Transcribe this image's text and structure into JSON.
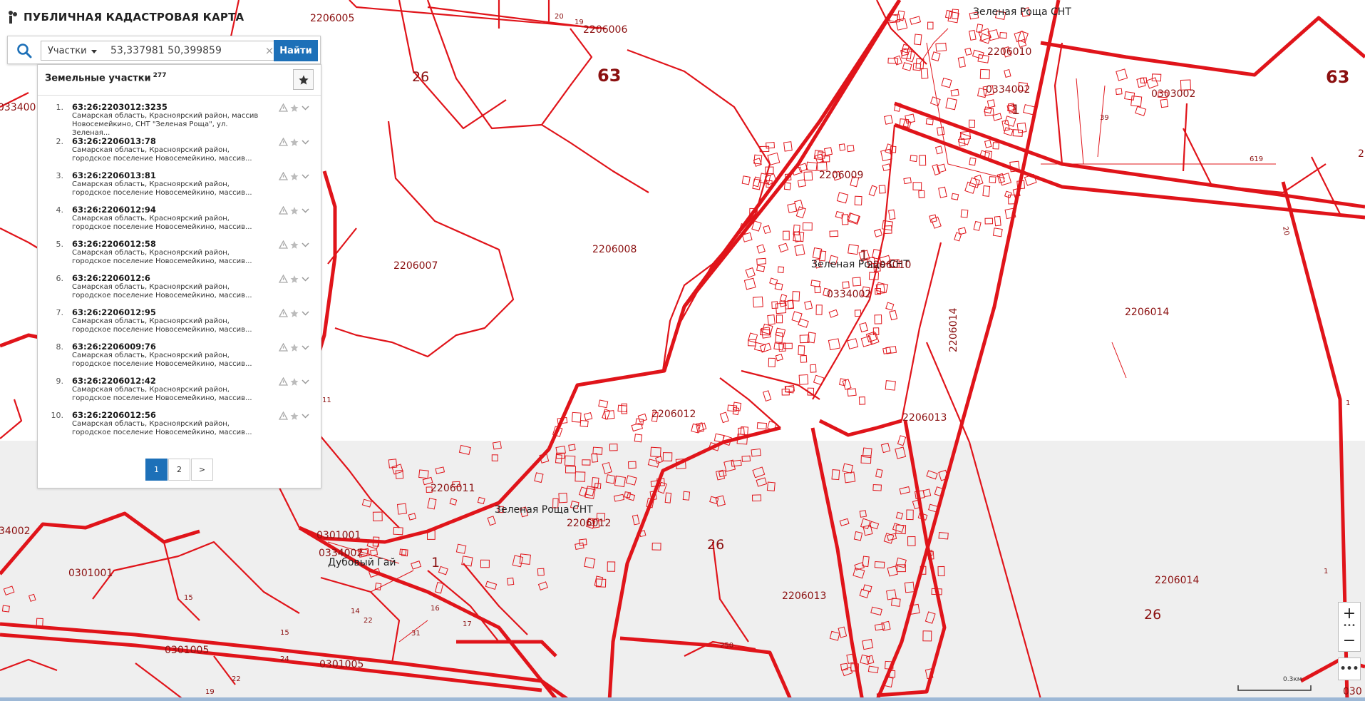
{
  "app": {
    "title": "ПУБЛИЧНАЯ КАДАСТРОВАЯ КАРТА"
  },
  "search": {
    "type_label": "Участки",
    "query": "53,337981 50,399859",
    "clear_symbol": "×",
    "find_label": "Найти"
  },
  "results": {
    "title": "Земельные участки",
    "count": "277",
    "items": [
      {
        "num": "1.",
        "code": "63:26:2203012:3235",
        "address": "Самарская область, Красноярский район, массив Новосемейкино, СНТ \"Зеленая Роща\", ул. Зеленая..."
      },
      {
        "num": "2.",
        "code": "63:26:2206013:78",
        "address": "Самарская область, Красноярский район, городское поселение Новосемейкино, массив..."
      },
      {
        "num": "3.",
        "code": "63:26:2206013:81",
        "address": "Самарская область, Красноярский район, городское поселение Новосемейкино, массив..."
      },
      {
        "num": "4.",
        "code": "63:26:2206012:94",
        "address": "Самарская область, Красноярский район, городское поселение Новосемейкино, массив..."
      },
      {
        "num": "5.",
        "code": "63:26:2206012:58",
        "address": "Самарская область, Красноярский район, городское поселение Новосемейкино, массив..."
      },
      {
        "num": "6.",
        "code": "63:26:2206012:6",
        "address": "Самарская область, Красноярский район, городское поселение Новосемейкино, массив..."
      },
      {
        "num": "7.",
        "code": "63:26:2206012:95",
        "address": "Самарская область, Красноярский район, городское поселение Новосемейкино, массив..."
      },
      {
        "num": "8.",
        "code": "63:26:2206009:76",
        "address": "Самарская область, Красноярский район, городское поселение Новосемейкино, массив..."
      },
      {
        "num": "9.",
        "code": "63:26:2206012:42",
        "address": "Самарская область, Красноярский район, городское поселение Новосемейкино, массив..."
      },
      {
        "num": "10.",
        "code": "63:26:2206012:56",
        "address": "Самарская область, Красноярский район, городское поселение Новосемейкино, массив..."
      }
    ],
    "pages": [
      "1",
      "2",
      ">"
    ],
    "active_page": "1"
  },
  "map": {
    "boundary_color": "#e0141a",
    "label_color": "#8b1010",
    "labels": {
      "q2206005": "2206005",
      "q2206006": "2206006",
      "d26_top": "26",
      "d63_top": "63",
      "d63_right": "63",
      "q0334001": "0334001",
      "q2206007": "2206007",
      "q2206008": "2206008",
      "q2206009": "2206009",
      "q2206010_top": "2206010",
      "q2206010_mid": "2206010",
      "q0334002_top": "0334002",
      "q0334002_mid": "0334002",
      "q0334002_low": "0334002",
      "q0334002_left": "34002",
      "q0303002": "0303002",
      "q2206014_a": "2206014",
      "q2206014_b": "2206014",
      "q2206014_c": "2206014",
      "q2206013_a": "2206013",
      "q2206013_b": "2206013",
      "q2206012_a": "2206012",
      "q2206012_b": "2206012",
      "q2206011": "2206011",
      "q0301001_a": "0301001",
      "q0301001_b": "0301001",
      "q0301005_a": "0301005",
      "q0301005_b": "0301005",
      "d26_mid": "26",
      "d26_right": "26",
      "n1_a": "1",
      "n1_b": "1",
      "n1_c": "1",
      "n1_d": "1",
      "n1_e": "1",
      "n11": "11",
      "n20": "20",
      "n19": "19",
      "n39": "39",
      "n619": "619",
      "n15_a": "15",
      "n15_b": "15",
      "n14": "14",
      "n22": "22",
      "n16": "16",
      "n17": "17",
      "n31": "31",
      "n250": "250",
      "n24": "24",
      "n19b": "19",
      "n22b": "22",
      "n2_right": "2",
      "n030_right": "030",
      "snt_top": "Зеленая Роща СНТ",
      "snt_mid": "Зеленая Роща СНТ",
      "snt_low": "Зеленая Роща СНТ",
      "dubovy": "Дубовый Гай"
    }
  },
  "controls": {
    "zoom_in": "+",
    "zoom_out": "−",
    "more": "•••",
    "scale": "0.3км"
  }
}
